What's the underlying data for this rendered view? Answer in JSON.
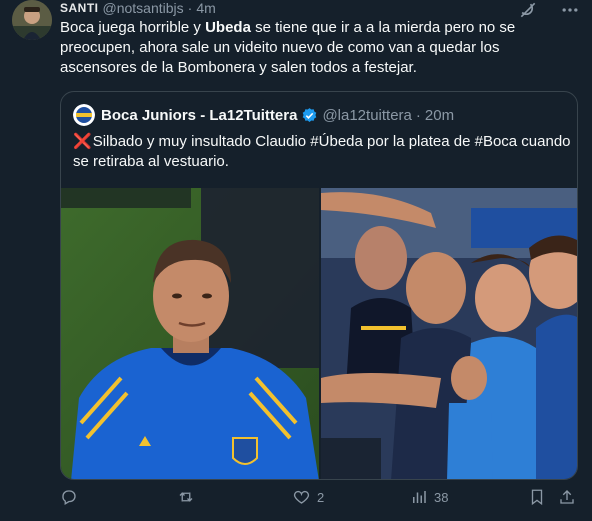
{
  "tweet": {
    "author_name": "SANTI",
    "handle": "@notsantibjs",
    "separator": "·",
    "time": "4m",
    "text_part1": "Boca juega horrible y ",
    "text_bold": "Ubeda",
    "text_part2": " se tiene que ir a a la mierda pero no se preocupen, ahora sale un videito nuevo de como van a quedar los ascensores de la Bombonera y salen todos a festejar."
  },
  "quote": {
    "author_name": "Boca Juniors - La12Tuittera",
    "handle": "@la12tuittera",
    "separator": "·",
    "time": "20m",
    "x_emoji": "❌",
    "text": "Silbado y muy insultado Claudio #Úbeda por la platea de #Boca cuando se retiraba al vestuario."
  },
  "actions": {
    "reply_count": "",
    "retweet_count": "",
    "like_count": "2",
    "views_count": "38"
  },
  "icons": {
    "grok": "grok-icon",
    "more": "more-icon",
    "verified": "verified-badge-icon",
    "reply": "reply-icon",
    "retweet": "retweet-icon",
    "like": "heart-icon",
    "views": "views-icon",
    "bookmark": "bookmark-icon",
    "share": "share-icon"
  },
  "colors": {
    "background": "#15202b",
    "text": "#f7f9f9",
    "muted": "#8b98a5",
    "border": "#38444d",
    "verified": "#1d9bf0",
    "x_mark": "#e0245e"
  }
}
